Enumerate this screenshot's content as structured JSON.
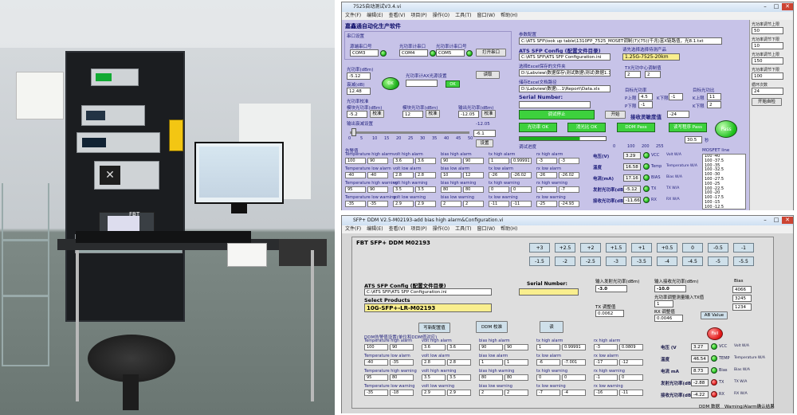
{
  "photo": {
    "screen_label": "FBT"
  },
  "top_window": {
    "title": "7525自动测试V3.4.vi",
    "menu": [
      "文件(F)",
      "编辑(E)",
      "查看(V)",
      "项目(P)",
      "操作(O)",
      "工具(T)",
      "窗口(W)",
      "帮助(H)"
    ],
    "app_title": "嘉鑫通自动化生产软件",
    "section_ports": "串口设置",
    "port_labels": [
      "源端串口号",
      "光功率计串口",
      "光功率计串口号"
    ],
    "port_values": [
      "COM3",
      "COM4",
      "COM5"
    ],
    "open_port_btn": "打开串口",
    "source_power_label": "光功率(dBm)",
    "source_power_value": "-5.12",
    "loss_label": "衰减(dB)",
    "loss_value": "12.48",
    "ok_btn": "OK",
    "set_label": "光功率计AX光源设置",
    "read_btn": "读取",
    "ok_btn2": "OK",
    "calib_label": "光功率校准",
    "calib_fields": [
      "-5.2",
      "12",
      "-12.05"
    ],
    "calib_headers": [
      "模块光功率(dBm)",
      "模块光功率(dBm)",
      "输出光功率(dBm)"
    ],
    "calib_btn": "校准",
    "slider_label": "输出衰减设置",
    "slider_ticks": [
      "0",
      "5",
      "10",
      "15",
      "20",
      "25",
      "30",
      "35",
      "40",
      "45",
      "50"
    ],
    "slider_value": "-12.05",
    "set_btn": "设置",
    "slider_readout": "-6.1",
    "right_section": "参数配置",
    "path1": "C:\\ATS SFP\\look up table\\1310FP_7525_MOSET调制(7)(75)(千兆)富X链路值，光8.1.txt",
    "config_title": "ATS SFP Config (配置文件目录)",
    "config_path": "C:\\ATS SFP\\ATS SFP Configuration.ini",
    "product_label": "请先选择选择待测产品",
    "product_value": "1.25G-7525-20km",
    "excel_label": "选择Excel保存的文件夹",
    "excel_path": "D:\\Labview\\数据保存\\测试数据\\测试\\数据1.12",
    "report_label": "储存Excel文档路径",
    "report_path": "D:\\Labview\\数据\\...1\\Report\\Data.xls",
    "serial_label": "Serial Number:",
    "tx_label": "TX光功中心调制值",
    "tx_values": [
      "2",
      "2"
    ],
    "rx_label": "RX光功 RX参数值",
    "target_label": "目标光功率",
    "target_fields": [
      "P上限",
      "P下限",
      "K下限"
    ],
    "target_values": [
      "4.5",
      "-1",
      "-1"
    ],
    "target_label2": "目标光功比",
    "target2_fields": [
      "K上限",
      "K下限"
    ],
    "target2_values": [
      "11",
      "2"
    ],
    "pause_btn": "调试停止",
    "open_btn": "开始",
    "rx_sens_label": "接收灵敏度值",
    "rx_sens_value": "-24",
    "status_btns": [
      "光功率 OK",
      "消光比 OK",
      "DDM Pass",
      "读写程序 Pass"
    ],
    "pass_btn": "Pass",
    "bar_ticks": [
      "0",
      "100",
      "200",
      "255"
    ],
    "progress_label": "调试进度",
    "extra_value": "30.5",
    "extra_unit": "秒",
    "table_section": "告警值",
    "th_cols": [
      "Temperature high alarm",
      "volt high alarm",
      "bias high alarm",
      "tx high alarm",
      "rx high alarm"
    ],
    "tl_cols": [
      "Temperature low alarm",
      "volt low alarm",
      "bias low alarm",
      "tx low alarm",
      "rx low alarm"
    ],
    "thw_cols": [
      "Temperature high warning",
      "volt high warning",
      "bias high warning",
      "tx high warning",
      "rx high warning"
    ],
    "tlw_cols": [
      "Temperature low warning",
      "volt low warning",
      "bias low warning",
      "tx low warning",
      "rx low warning"
    ],
    "row_ha": [
      "100",
      "90",
      "3.6",
      "3.6",
      "90",
      "90",
      "1",
      "0.99991",
      "-3",
      "-3"
    ],
    "row_la": [
      "-40",
      "-40",
      "2.8",
      "2.8",
      "10",
      "12",
      "-26",
      "-26.02",
      "-26",
      "-26.02"
    ],
    "row_hw": [
      "95",
      "90",
      "3.5",
      "3.5",
      "80",
      "80",
      "0",
      "0",
      "-7",
      "-7"
    ],
    "row_lw": [
      "-35",
      "-35",
      "2.9",
      "2.9",
      "2",
      "2",
      "-11",
      "-11",
      "-25",
      "-24.93"
    ],
    "mon_labels": [
      "电压(V)",
      "温度",
      "电流(mA)",
      "发射光功率(dBm)",
      "接收光功率(dBm)"
    ],
    "mon_values": [
      "3.29",
      "16.58",
      "17.16",
      "-5.12",
      "-11.66"
    ],
    "mon_tags": [
      "VCC",
      "Temp",
      "BIAS",
      "TX",
      "RX"
    ],
    "mon_wa": [
      "Volt W/A",
      "Temperature W/A",
      "Bias W/A",
      "TX W/A",
      "RX W/A"
    ],
    "mosfet_label": "MOSFET line",
    "mosfet_lines": [
      "100 -40",
      "100 -37.5",
      "100 -35",
      "100 -32.5",
      "100 -30",
      "100 -27.5",
      "100 -25",
      "100 -22.5",
      "100 -20",
      "100 -17.5",
      "100 -15",
      "100 -12.5"
    ],
    "side_labels": [
      "光功率调节上限",
      "光功率调节下限",
      "光功率调节上限",
      "光功率调节下限",
      "循环次数"
    ],
    "side_values": [
      "50",
      "10",
      "150",
      "100",
      "24"
    ],
    "side_btn": "开始自检"
  },
  "bottom_window": {
    "title": "SFP+ DDM V2.5-M02193-add bias high alarm&Configuration.vi",
    "menu": [
      "文件(F)",
      "编辑(E)",
      "查看(V)",
      "项目(P)",
      "操作(O)",
      "工具(T)",
      "窗口(W)",
      "帮助(H)"
    ],
    "header": "FBT SFP+ DDM M02193",
    "nums_row1": [
      "+3",
      "+2.5",
      "+2",
      "+1.5",
      "+1",
      "+0.5",
      "0",
      "-0.5",
      "-1"
    ],
    "nums_row2": [
      "-1.5",
      "-2",
      "-2.5",
      "-3",
      "-3.5",
      "-4",
      "-4.5",
      "-5",
      "-5.5"
    ],
    "config_title": "ATS SFP Config (配置文件目录)",
    "config_path": "C:\\ATS SFP\\ATS SFP Configuration.ini",
    "select_label": "Select Products",
    "product_value": "10G-SFP+-LR-M02193",
    "serial_label": "Serial Number:",
    "in_power_label": "输入发射光功率(dBm)",
    "in_power_value": "-3.0",
    "in_rx_label": "输入接收光功率(dBm)",
    "in_rx_value": "-10.0",
    "tx_label": "TX 调整值",
    "tx_value": "0.0062",
    "rx_label": "RX 调整值",
    "rx_value": "0.0046",
    "ratio_label": "光功率调整测量输入TX值",
    "ratio_value": "1",
    "bias_label": "Bias",
    "bias_values": [
      "4066",
      "3245",
      "1234"
    ],
    "btn1": "写新配置值",
    "btn2": "DDM 校准",
    "btn3": "读",
    "btn4": "AB Value",
    "alarm_label": "DDM告警值设置(单位和DDM值对应)",
    "row_ha": [
      "100",
      "90",
      "3.6",
      "3.6",
      "90",
      "90",
      "1",
      "0.99991",
      "-3",
      "0.0809"
    ],
    "row_la": [
      "-40",
      "-35",
      "2.8",
      "2.8",
      "1",
      "1",
      "-6",
      "-7.001",
      "-17",
      "-12"
    ],
    "row_hw": [
      "95",
      "80",
      "3.5",
      "3.5",
      "80",
      "80",
      "0",
      "0",
      "-1",
      "0"
    ],
    "row_lw": [
      "-35",
      "-18",
      "2.9",
      "2.9",
      "2",
      "2",
      "-7",
      "-4",
      "-16",
      "-11"
    ],
    "th_cols": [
      "Temperature high alarm",
      "volt high alarm",
      "bias high alarm",
      "tx high alarm",
      "rx high alarm"
    ],
    "tl_cols": [
      "Temperature low alarm",
      "volt low alarm",
      "bias low alarm",
      "tx low alarm",
      "rx low alarm"
    ],
    "thw_cols": [
      "Temperature high warning",
      "volt high warning",
      "bias high warning",
      "tx high warning",
      "rx high warning"
    ],
    "tlw_cols": [
      "Temperature low warning",
      "volt low warning",
      "bias low warning",
      "tx low warning",
      "rx low warning"
    ],
    "mon_labels": [
      "电压 (V",
      "温度",
      "电流 mA",
      "发射光功率(dB",
      "接收光功率(dB"
    ],
    "mon_values": [
      "3.27",
      "46.54",
      "8.73",
      "-2.88",
      "-4.22"
    ],
    "mon_tags": [
      "VCC",
      "TEMP",
      "Bias",
      "TX",
      "RX"
    ],
    "mon_wa": [
      "Volt W/A",
      "Temperature W/A",
      "Bias W/A",
      "TX W/A",
      "RX W/A"
    ],
    "fail_label": "Fail",
    "footer_ddm": "DDM 数据",
    "footer_warn": "Warning/Alarm确认结果"
  }
}
